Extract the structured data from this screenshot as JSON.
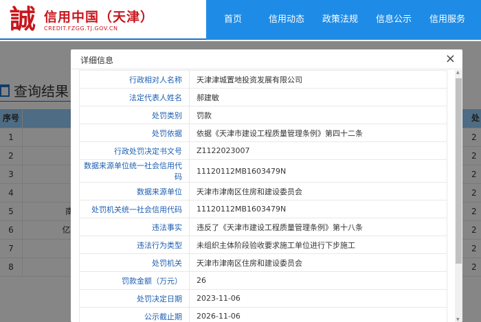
{
  "header": {
    "logo_glyph": "誠",
    "title": "信用中国（天津）",
    "url": "CREDIT.FZGG.TJ.GOV.CN",
    "nav": [
      "首页",
      "信用动态",
      "政策法规",
      "信息公示",
      "信用服务"
    ]
  },
  "results": {
    "title": "查询结果",
    "col_index": "序号",
    "col_last": "处",
    "rows": [
      {
        "i": "1",
        "name": "",
        "last": "2"
      },
      {
        "i": "2",
        "name": "",
        "last": "2"
      },
      {
        "i": "3",
        "name": "",
        "last": "2"
      },
      {
        "i": "4",
        "name": "",
        "last": "2"
      },
      {
        "i": "5",
        "name": "南通后",
        "last": "2"
      },
      {
        "i": "6",
        "name": "亿居(上",
        "last": "2"
      },
      {
        "i": "7",
        "name": "",
        "last": "2"
      },
      {
        "i": "8",
        "name": "",
        "last": "2"
      }
    ]
  },
  "modal": {
    "title": "详细信息",
    "close": "×",
    "fields": [
      {
        "label": "行政相对人名称",
        "value": "天津津城置地投资发展有限公司"
      },
      {
        "label": "法定代表人姓名",
        "value": "郝建敏"
      },
      {
        "label": "处罚类别",
        "value": "罚款"
      },
      {
        "label": "处罚依据",
        "value": "依据《天津市建设工程质量管理条例》第四十二条"
      },
      {
        "label": "行政处罚决定书文号",
        "value": "Z1122023007"
      },
      {
        "label": "数据来源单位统一社会信用代码",
        "value": "11120112MB1603479N"
      },
      {
        "label": "数据来源单位",
        "value": "天津市津南区住房和建设委员会"
      },
      {
        "label": "处罚机关统一社会信用代码",
        "value": "11120112MB1603479N"
      },
      {
        "label": "违法事实",
        "value": "违反了《天津市建设工程质量管理条例》第十八条"
      },
      {
        "label": "违法行为类型",
        "value": "未组织主体阶段验收要求施工单位进行下步施工"
      },
      {
        "label": "处罚机关",
        "value": "天津市津南区住房和建设委员会"
      },
      {
        "label": "罚款金额（万元）",
        "value": "26"
      },
      {
        "label": "处罚决定日期",
        "value": "2023-11-06"
      },
      {
        "label": "公示截止期",
        "value": "2026-11-06"
      }
    ]
  }
}
